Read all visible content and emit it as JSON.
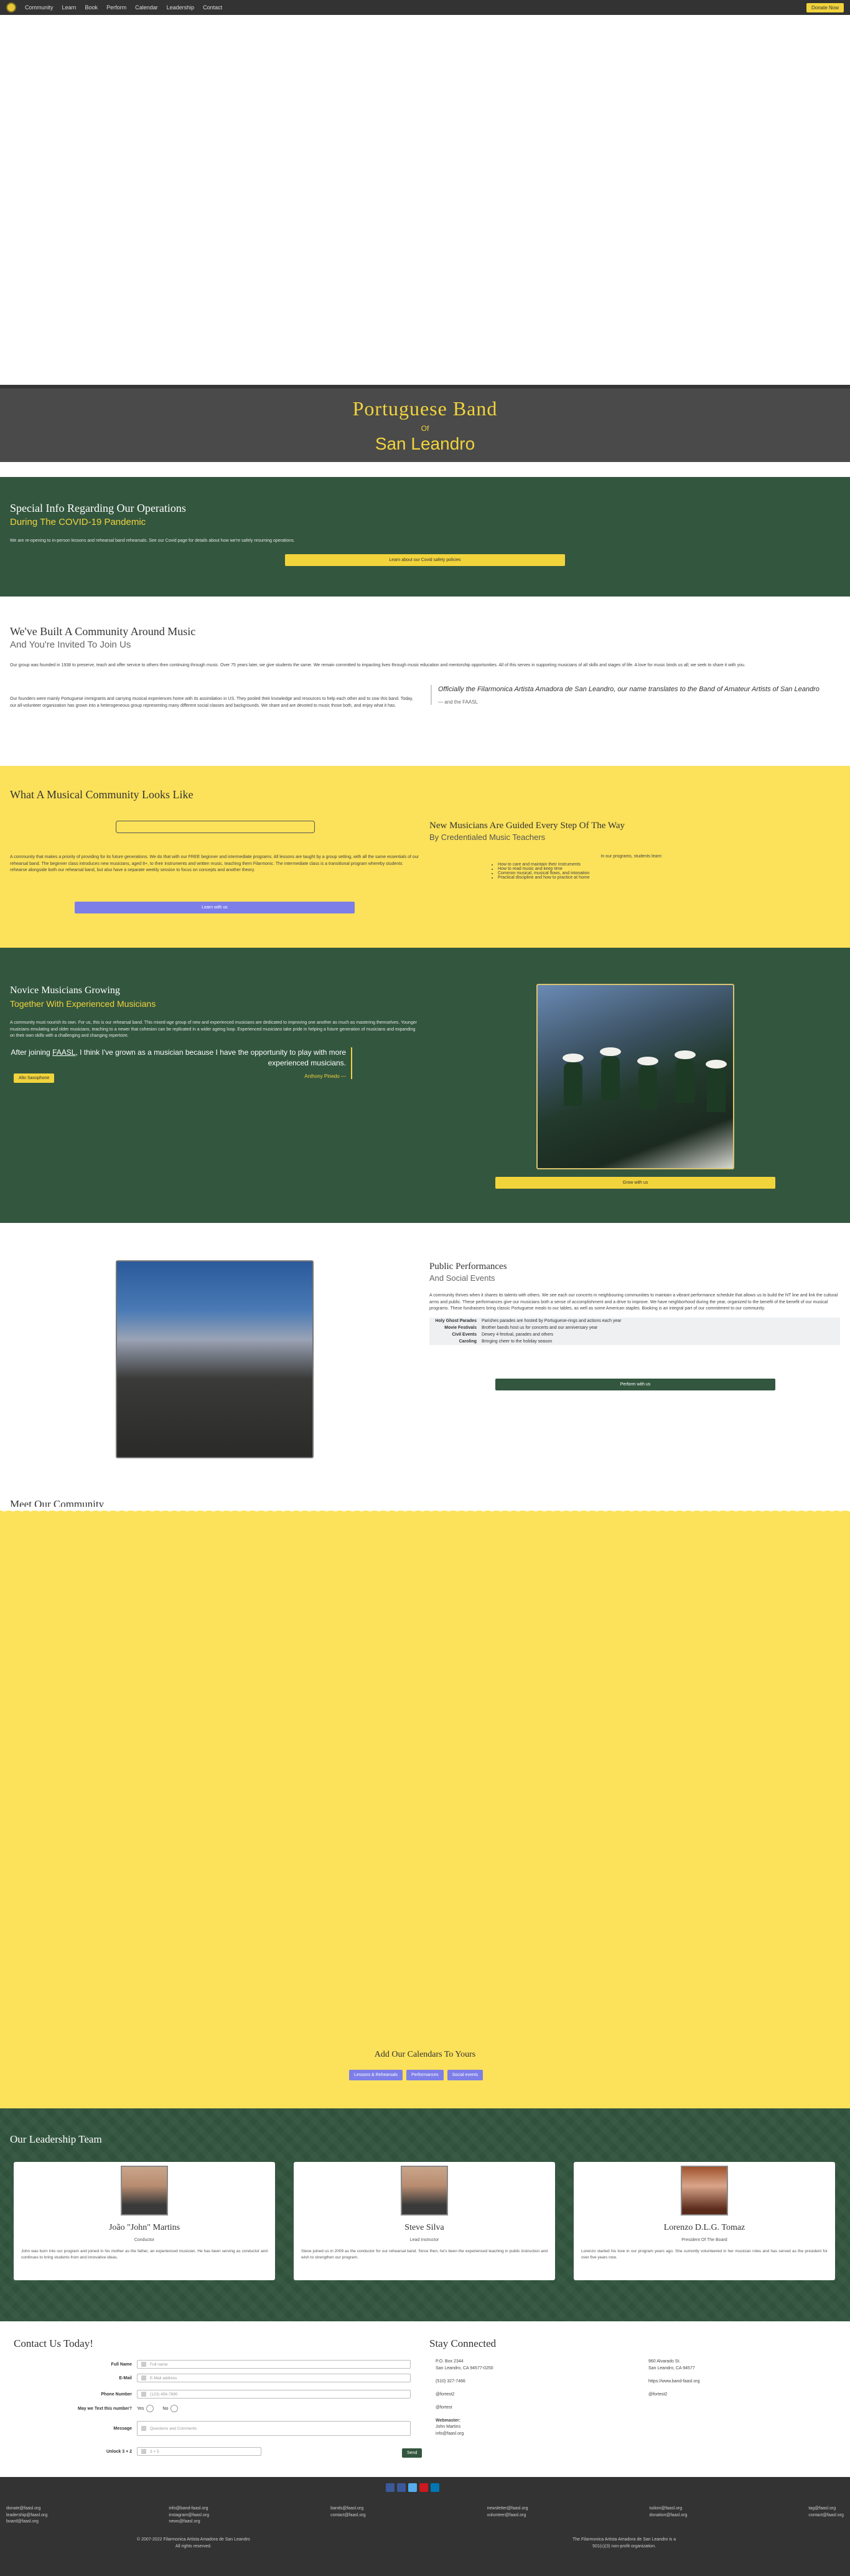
{
  "nav": {
    "items": [
      "Community",
      "Learn",
      "Book",
      "Perform",
      "Calendar",
      "Leadership",
      "Contact"
    ],
    "donate": "Donate Now"
  },
  "hero": {
    "title": "Portuguese Band",
    "of": "Of",
    "city": "San Leandro"
  },
  "covid": {
    "title": "Special Info Regarding Our Operations",
    "subtitle": "During The COVID-19 Pandemic",
    "body": "We are re-opening to in-person lessons and rehearsal band rehearsals. See our Covid page for details about how we're safely resuming operations.",
    "button": "Learn about our Covid safety policies"
  },
  "community": {
    "title": "We've Built A Community Around Music",
    "subtitle": "And You're Invited To Join Us",
    "p1": "Our group was founded in 1938 to preserve, teach and offer service to others then continuing through music. Over 75 years later, we give students the same. We remain committed to impacting lives through music education and mentorship opportunities. All of this serves in supporting musicians of all skills and stages of life. A love for music binds us all; we seek to share it with you.",
    "p2": "Our founders were mainly Portuguese immigrants and carrying musical experiences home with its assimilation in US. They pooled their knowledge and resources to help each other and to sow this band. Today, our all-volunteer organization has grown into a heterogeneous group representing many different social classes and backgrounds. We share and are devoted to music those both, and enjoy what it has.",
    "quote": "Officially the Filarmonica Artista Amadora de San Leandro, our name translates to the Band of Amateur Artists of San Leandro",
    "cite": "— and the FAASL"
  },
  "looks": {
    "title": "What A Musical Community Looks Like",
    "para": "A community that makes a priority of providing for its future generations. We do that with our FREE beginner and intermediate programs. All lessons are taught by a group setting, with all the same essentials of our rehearsal band. The beginner class introduces new musicians, aged 8+, to their instruments and written music, teaching them Filarmonic. The intermediate class is a transitional program whereby students rehearse alongside both our rehearsal band, but also have a separate weekly session to focus on concepts and another theory.",
    "button": "Learn with us",
    "right_title": "New Musicians Are Guided Every Step Of The Way",
    "right_sub": "By Credentialed Music Teachers",
    "right_small": "In our programs, students learn:",
    "bullets": [
      "How to care and maintain their instruments",
      "How to read music and keep time",
      "Common musical, musical flows, and intonation",
      "Practical discipline and how to practice at home"
    ]
  },
  "novice": {
    "title": "Novice Musicians Growing",
    "subtitle": "Together With Experienced Musicians",
    "para": "A community must nourish its own. For us, this is our rehearsal band. This mixed-age group of new and experienced musicians are dedicated to improving one another as much as mastering themselves. Younger musicians emulating and older musicians, teaching to a newer that cohesion can be replicated in a wider ageing loop. Experienced musicians take pride in helping a future generation of musicians and expanding on their own skills with a challenging and changing repertoire.",
    "quote_pre": "After joining ",
    "quote_link": "FAASL",
    "quote_post": ", I think I've grown as a musician because I have the opportunity to play with more experienced musicians.",
    "who": "Anthony Pinedo —",
    "small_btn": "Alto Saxophone",
    "button": "Grow with us"
  },
  "public": {
    "title": "Public Performances",
    "subtitle": "And Social Events",
    "para": "A community thrives when it shares its talents with others. We see each our concerts in neighbouring communities to maintain a vibrant performance schedule that allows us to build the NT line and link the cultural arms and public. These performances give our musicians both a sense of accomplishment and a drive to improve. We have neighborhood during the year, organized to the benefit of the benefit of our musical programs. These fundraisers bring classic Portuguese meals to our tables, as well as some American staples. Booking is an integral part of our commitment to our community.",
    "table": [
      {
        "k": "Holy Ghost Parades",
        "v": "Parishes parades are hosted by Portuguese-rings and actions each year"
      },
      {
        "k": "Movie Festivals",
        "v": "Brother bands host us for concerts and our anniversary year"
      },
      {
        "k": "Civil Events",
        "v": "Dewey 4 festival, parades and others"
      },
      {
        "k": "Caroling",
        "v": "Bringing cheer to the holiday season"
      }
    ],
    "button": "Perform with us"
  },
  "meet": {
    "title": "Meet Our Community",
    "cal_title": "Add Our Calendars To Yours",
    "cal_buttons": [
      "Lessons & Rehearsals",
      "Performances",
      "Social events"
    ]
  },
  "leadership": {
    "title": "Our Leadership Team",
    "members": [
      {
        "name": "João \"John\" Martins",
        "role": "Conductor",
        "bio": "John was born into our program and joined in his mother as the father, an experienced musician. He has been serving as conductor and continues to bring students from and innovative ideas."
      },
      {
        "name": "Steve Silva",
        "role": "Lead Instructor",
        "bio": "Steve joined us in 2009 as the conductor for our rehearsal band. Since then, he's been the experienced teaching in public instruction and wish to strengthen our program."
      },
      {
        "name": "Lorenzo D.L.G. Tomaz",
        "role": "President Of The Board",
        "bio": "Lorenzo started his love in our program years ago. She currently volunteered in her musician roles and has served as the president for over five years now."
      }
    ]
  },
  "contact": {
    "title": "Contact Us Today!",
    "fields": [
      {
        "label": "Full Name",
        "placeholder": "Full name"
      },
      {
        "label": "E-Mail",
        "placeholder": "E-Mail address"
      },
      {
        "label": "Phone Number",
        "placeholder": "(123) 456-7890"
      },
      {
        "label": "May we Text this number?",
        "radio": [
          "Yes",
          "No"
        ]
      },
      {
        "label": "Message",
        "placeholder": "Questions and Comments"
      },
      {
        "label": "Unlock 3 + 2",
        "placeholder": "3 + 5"
      }
    ],
    "send": "Send",
    "stay_title": "Stay Connected",
    "col1": [
      "P.O. Box 2344",
      "San Leandro, CA 94577-0250",
      "",
      "(510) 327-7466",
      "",
      "@fortest2",
      "",
      "@fortest",
      "",
      "Webmaster:",
      "John Martins",
      "info@faasl.org"
    ],
    "col2": [
      "960 Alvarado St.",
      "San Leandro, CA 94577",
      "",
      "https://www.band-faasl.org",
      "",
      "@fortest2"
    ]
  },
  "footer": {
    "links": [
      [
        "donate@faasl.org",
        "leadership@faasl.org",
        "board@faasl.org"
      ],
      [
        "info@band-faasl.org",
        "instagram@faasl.org",
        "news@faasl.org"
      ],
      [
        "bands@faasl.org",
        "contact@faasl.org"
      ],
      [
        "newsletter@faasl.org",
        "volunteer@faasl.org"
      ],
      [
        "tuition@faasl.org",
        "donation@faasl.org"
      ],
      [
        "tag@faasl.org",
        "contact@faasl.org"
      ]
    ],
    "copy1": "© 2007-2022 Filarmonica Artista Amadora de San Leandro",
    "copy2": "All rights reserved.",
    "npo1": "The Filarmonica Artista Amadora de San Leandro is a",
    "npo2": "501(c)(3) non-profit organization.",
    "social_colors": [
      "#3b5998",
      "#3b5998",
      "#55acee",
      "#cc181e",
      "#0077b5"
    ]
  }
}
